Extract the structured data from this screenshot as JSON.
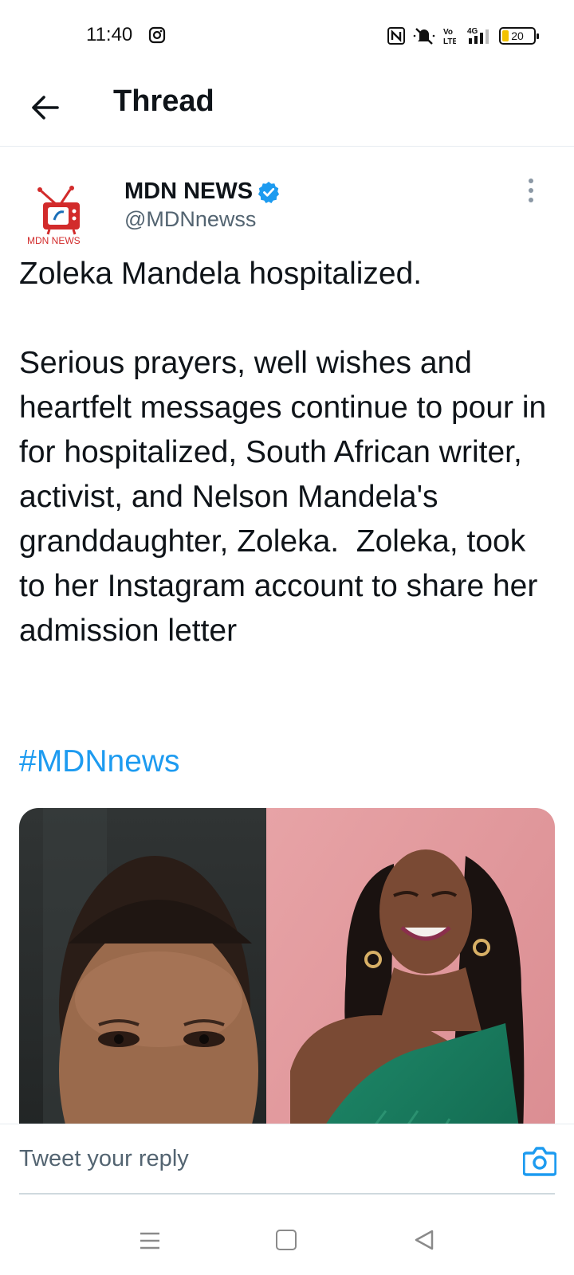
{
  "status_bar": {
    "time": "11:40",
    "battery": "20",
    "icons": [
      "instagram-icon",
      "nfc-icon",
      "mute-icon",
      "volte-icon",
      "signal-4g-icon",
      "battery-icon"
    ]
  },
  "header": {
    "title": "Thread",
    "back_icon": "arrow-left-icon"
  },
  "tweet": {
    "author_name": "MDN NEWS",
    "author_handle": "@MDNnewss",
    "verified": true,
    "avatar_text": "MDN NEWS",
    "text": "Zoleka Mandela hospitalized.\n\nSerious prayers, well wishes and heartfelt messages continue to pour in for hospitalized, South African writer, activist, and Nelson Mandela's granddaughter, Zoleka.  Zoleka, took to her Instagram account to share her admission letter",
    "hashtag": "#MDNnews",
    "more_icon": "more-vertical-icon"
  },
  "reply": {
    "placeholder": "Tweet your reply",
    "camera_icon": "camera-icon"
  },
  "colors": {
    "link": "#1d9bf0",
    "secondary_text": "#536471",
    "divider": "#e6ecf0",
    "battery_fill": "#f2c200"
  },
  "nav_bar": {
    "icons": [
      "menu-icon",
      "home-square-icon",
      "back-triangle-icon"
    ]
  }
}
